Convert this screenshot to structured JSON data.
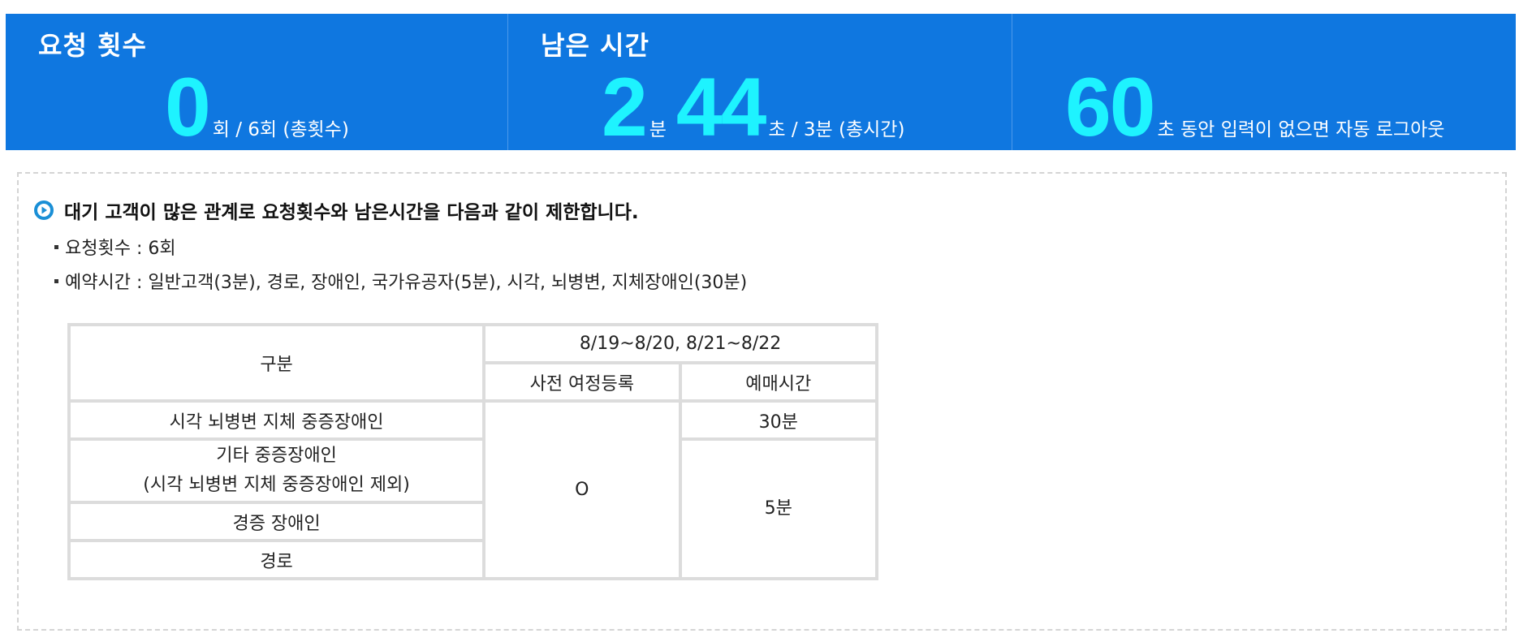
{
  "counter": {
    "requests": {
      "title": "요청 횟수",
      "value": "0",
      "suffix": "회 / 6회 (총횟수)"
    },
    "remaining": {
      "title": "남은 시간",
      "minutes": "2",
      "min_unit": "분",
      "seconds": "44",
      "suffix": "초 / 3분 (총시간)"
    },
    "logout": {
      "value": "60",
      "suffix": "초 동안 입력이 없으면 자동 로그아웃"
    }
  },
  "notice": {
    "headline": "대기 고객이 많은 관계로 요청횟수와 남은시간을 다음과 같이 제한합니다.",
    "bullets": [
      "요청횟수 : 6회",
      "예약시간 : 일반고객(3분), 경로, 장애인, 국가유공자(5분), 시각, 뇌병변, 지체장애인(30분)"
    ]
  },
  "table": {
    "col_category": "구분",
    "date_range": "8/19~8/20, 8/21~8/22",
    "sub_headers": [
      "사전 여정등록",
      "예매시간"
    ],
    "rows": [
      "시각 뇌병변 지체 중증장애인",
      [
        "기타 중증장애인",
        "(시각 뇌병변 지체 중증장애인 제외)"
      ],
      "경증 장애인",
      "경로"
    ],
    "preregister_mark": "O",
    "time_severe": "30분",
    "time_others": "5분"
  },
  "colors": {
    "banner_bg": "#0f77e0",
    "big_number": "#1ef3ff",
    "icon_blue": "#1a8fd6"
  }
}
